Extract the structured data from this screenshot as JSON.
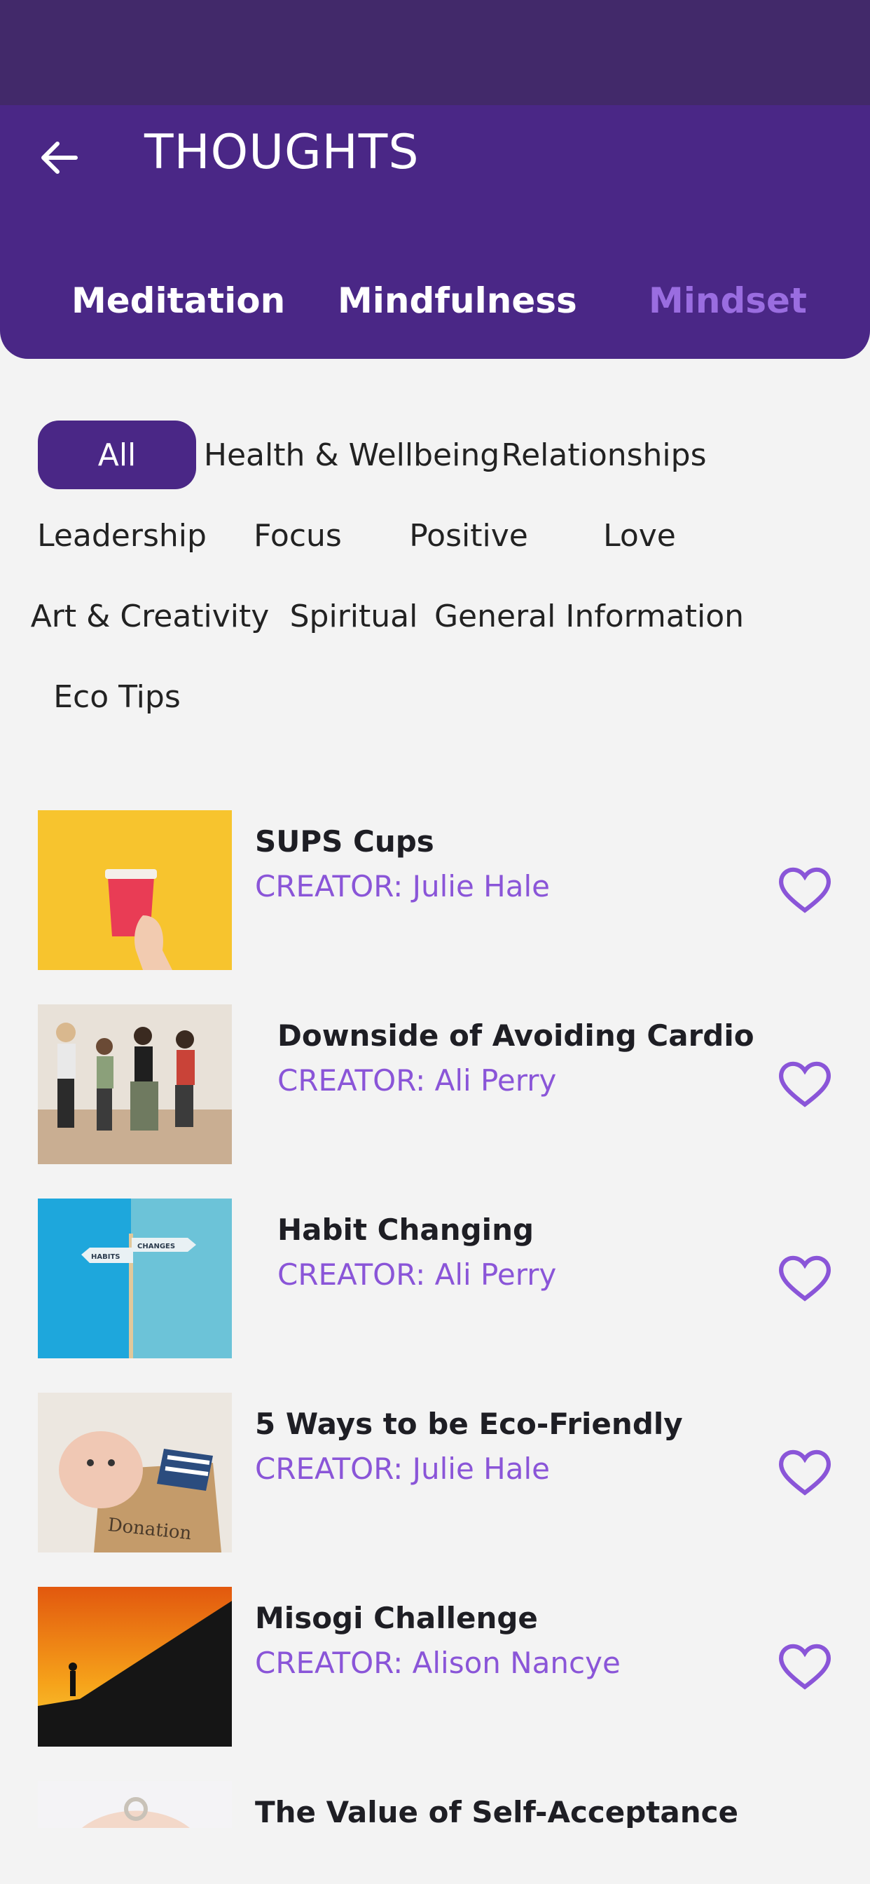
{
  "header": {
    "title": "THOUGHTS",
    "tabs": [
      {
        "label": "Meditation",
        "active": false
      },
      {
        "label": "Mindfulness",
        "active": false
      },
      {
        "label": "Mindset",
        "active": true
      }
    ]
  },
  "filters": {
    "selected": "All",
    "chips": [
      "All",
      "Health & Wellbeing",
      "Relationships",
      "Leadership",
      "Focus",
      "Positive",
      "Love",
      "Art & Creativity",
      "Spiritual",
      "General Information",
      "Eco Tips"
    ]
  },
  "items": [
    {
      "title": "SUPS Cups",
      "creator": "CREATOR: Julie Hale"
    },
    {
      "title": "Downside of Avoiding Cardio",
      "creator": "CREATOR: Ali Perry"
    },
    {
      "title": "Habit Changing",
      "creator": "CREATOR: Ali Perry"
    },
    {
      "title": "5 Ways to be Eco-Friendly",
      "creator": "CREATOR: Julie Hale"
    },
    {
      "title": "Misogi Challenge",
      "creator": "CREATOR: Alison Nancye"
    },
    {
      "title": "The Value of Self-Acceptance",
      "creator": ""
    }
  ],
  "thumb_text": {
    "habits": "HABITS",
    "changes": "CHANGES",
    "donation": "Donation"
  },
  "colors": {
    "status_bar": "#42296a",
    "header": "#4a2786",
    "accent": "#8a55d8",
    "active_tab": "#9a6de0"
  },
  "icons": {
    "back": "arrow-left-icon",
    "favorite": "heart-outline-icon"
  }
}
